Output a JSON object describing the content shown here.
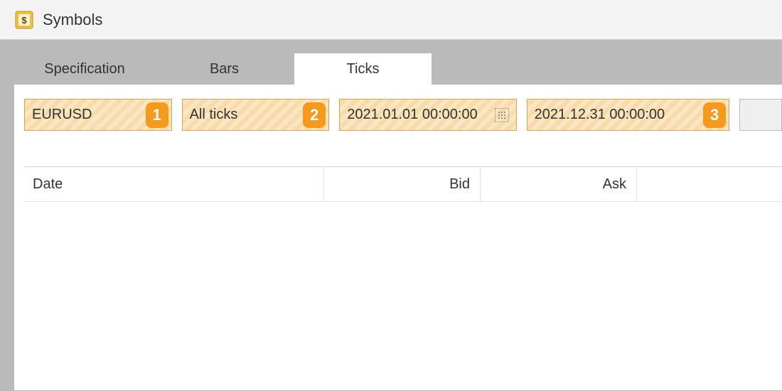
{
  "window": {
    "title": "Symbols"
  },
  "tabs": [
    {
      "label": "Specification",
      "active": false
    },
    {
      "label": "Bars",
      "active": false
    },
    {
      "label": "Ticks",
      "active": true
    }
  ],
  "filters": {
    "symbol": "EURUSD",
    "tick_type": "All ticks",
    "date_from": "2021.01.01 00:00:00",
    "date_to": "2021.12.31 00:00:00"
  },
  "annotations": {
    "badge1": "1",
    "badge2": "2",
    "badge3": "3"
  },
  "grid": {
    "columns": {
      "date": "Date",
      "bid": "Bid",
      "ask": "Ask"
    }
  }
}
